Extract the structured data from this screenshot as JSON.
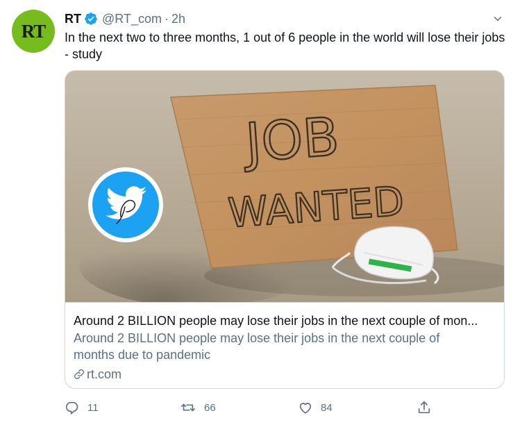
{
  "author": {
    "avatar_text": "RT",
    "name": "RT",
    "handle": "@RT_com",
    "separator": "·",
    "time": "2h"
  },
  "tweet": {
    "text": "In the next two to three months, 1 out of 6 people in the world will lose their jobs - study"
  },
  "card": {
    "image_texts": [
      "JOB",
      "WANTED"
    ],
    "title": "Around 2 BILLION people may lose their jobs in the next couple of mon...",
    "description": "Around 2 BILLION people may lose their jobs in the next couple of months due to pandemic",
    "domain": "rt.com"
  },
  "actions": {
    "replies": "11",
    "retweets": "66",
    "likes": "84"
  },
  "colors": {
    "avatar_bg": "#77bc1f",
    "verified": "#1da1f2",
    "muted_text": "#5b7083",
    "border": "#cfd9de"
  },
  "icons": [
    "verified-badge-icon",
    "chevron-down-icon",
    "link-icon",
    "reply-icon",
    "retweet-icon",
    "like-icon",
    "share-icon",
    "twitter-watermark-icon"
  ]
}
